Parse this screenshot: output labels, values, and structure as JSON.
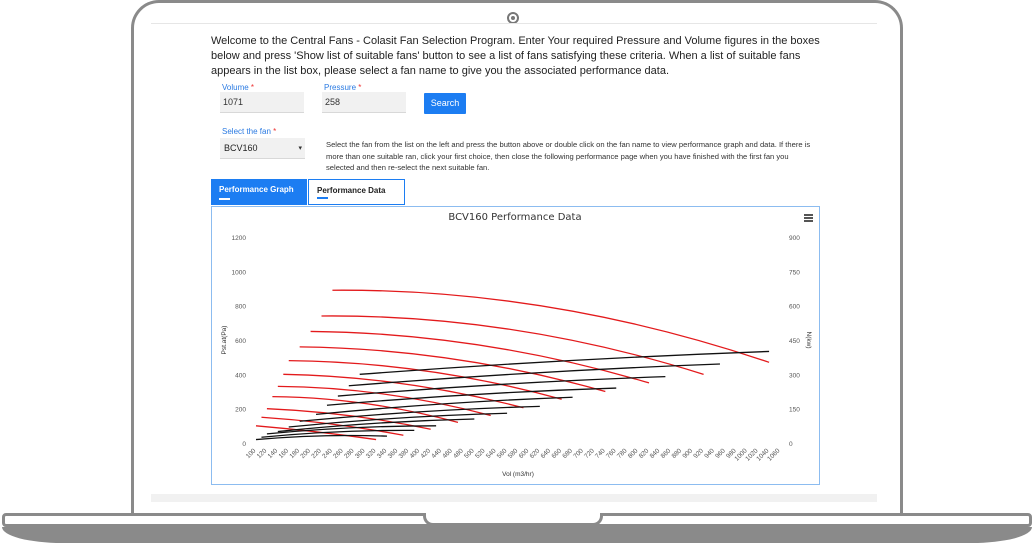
{
  "intro": "Welcome to the Central Fans - Colasit Fan Selection Program. Enter Your required Pressure and Volume figures in the boxes below and press 'Show list of suitable fans' button to see a list of fans satisfying these criteria. When a list of suitable fans appears in the list box, please select a fan name to give you the associated performance data.",
  "form": {
    "volume_label": "Volume",
    "volume_value": "1071",
    "pressure_label": "Pressure",
    "pressure_value": "258",
    "required_mark": "*",
    "search_label": "Search",
    "select_label": "Select the fan",
    "select_value": "BCV160",
    "select_caret": "▾"
  },
  "help_text": "Select the fan from the list on the left and press the button above or double click on the fan name to view performance graph and data. If there is more than one suitable ran, click your first choice, then close the following performance page when you have finished with the first fan you selected and then re-select the next suitable fan.",
  "tabs": [
    {
      "label": "Performance Graph",
      "active": true
    },
    {
      "label": "Performance Data",
      "active": false
    }
  ],
  "icons": {
    "menu": "hamburger-menu-icon"
  },
  "colors": {
    "accent": "#1c7df2",
    "pressure_curve": "#e31a1c",
    "power_curve": "#111111"
  },
  "chart_data": {
    "type": "line",
    "title": "BCV160 Performance Data",
    "xlabel": "Vol (m3/hr)",
    "ylabel_left": "Pst.at(Pa)",
    "ylabel_right": "N(kw)",
    "x_ticks": [
      "100",
      "120",
      "140",
      "160",
      "180",
      "200",
      "220",
      "240",
      "260",
      "280",
      "300",
      "320",
      "340",
      "360",
      "380",
      "400",
      "420",
      "440",
      "460",
      "480",
      "500",
      "520",
      "540",
      "560",
      "580",
      "600",
      "620",
      "640",
      "660",
      "680",
      "700",
      "720",
      "740",
      "760",
      "780",
      "800",
      "820",
      "840",
      "860",
      "880",
      "900",
      "920",
      "940",
      "960",
      "980",
      "1000",
      "1020",
      "1040",
      "1060"
    ],
    "y_left_ticks": [
      "0",
      "200",
      "400",
      "600",
      "800",
      "1000",
      "1200"
    ],
    "y_right_ticks": [
      "0",
      "150",
      "300",
      "450",
      "600",
      "750",
      "900"
    ],
    "xlim": [
      100,
      1060
    ],
    "ylim_left": [
      0,
      1200
    ],
    "ylim_right": [
      0,
      900
    ],
    "pressure_curves": [
      {
        "x": [
          100,
          210,
          320
        ],
        "y": [
          100,
          65,
          20
        ]
      },
      {
        "x": [
          110,
          240,
          370
        ],
        "y": [
          150,
          110,
          45
        ]
      },
      {
        "x": [
          120,
          270,
          420
        ],
        "y": [
          200,
          160,
          80
        ]
      },
      {
        "x": [
          130,
          300,
          470
        ],
        "y": [
          270,
          230,
          120
        ]
      },
      {
        "x": [
          140,
          335,
          530
        ],
        "y": [
          330,
          285,
          160
        ]
      },
      {
        "x": [
          150,
          370,
          590
        ],
        "y": [
          400,
          345,
          205
        ]
      },
      {
        "x": [
          160,
          410,
          660
        ],
        "y": [
          480,
          420,
          255
        ]
      },
      {
        "x": [
          180,
          460,
          740
        ],
        "y": [
          560,
          490,
          300
        ]
      },
      {
        "x": [
          200,
          510,
          820
        ],
        "y": [
          650,
          570,
          350
        ]
      },
      {
        "x": [
          220,
          570,
          920
        ],
        "y": [
          740,
          660,
          400
        ]
      },
      {
        "x": [
          240,
          640,
          1040
        ],
        "y": [
          890,
          790,
          470
        ]
      }
    ],
    "power_curves": [
      {
        "x": [
          100,
          340
        ],
        "y": [
          15,
          30
        ]
      },
      {
        "x": [
          110,
          390
        ],
        "y": [
          25,
          55
        ]
      },
      {
        "x": [
          120,
          430
        ],
        "y": [
          40,
          75
        ]
      },
      {
        "x": [
          140,
          500
        ],
        "y": [
          50,
          105
        ]
      },
      {
        "x": [
          160,
          560
        ],
        "y": [
          70,
          130
        ]
      },
      {
        "x": [
          180,
          620
        ],
        "y": [
          95,
          160
        ]
      },
      {
        "x": [
          210,
          680
        ],
        "y": [
          125,
          200
        ]
      },
      {
        "x": [
          230,
          760
        ],
        "y": [
          165,
          240
        ]
      },
      {
        "x": [
          250,
          850
        ],
        "y": [
          205,
          290
        ]
      },
      {
        "x": [
          270,
          950
        ],
        "y": [
          250,
          345
        ]
      },
      {
        "x": [
          290,
          1040
        ],
        "y": [
          300,
          400
        ]
      }
    ]
  }
}
